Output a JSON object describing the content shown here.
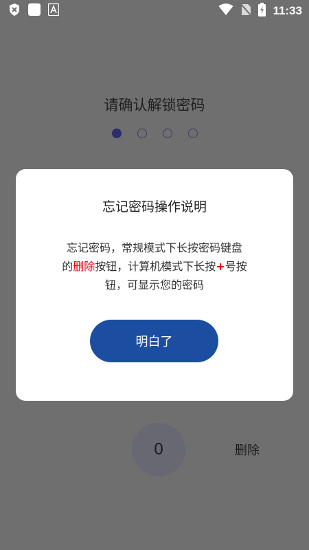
{
  "status_bar": {
    "time": "11:33",
    "icons": [
      "shield-x-icon",
      "square-icon",
      "font-a-icon",
      "wifi-icon",
      "no-sim-icon",
      "battery-charging-icon"
    ]
  },
  "screen": {
    "title": "请确认解锁密码",
    "pin_dots": {
      "filled": 1,
      "total": 4
    },
    "keypad": {
      "zero": "0",
      "delete": "删除"
    }
  },
  "dialog": {
    "title": "忘记密码操作说明",
    "body": {
      "line1": "忘记密码，常规模式下长按密码键盘",
      "line2_pre": "的",
      "line2_red": "删除",
      "line2_mid": "按钮，计算机模式下长按",
      "line2_plus": "+",
      "line2_post": "号按",
      "line3": "钮，可显示您的密码"
    },
    "ok_label": "明白了"
  }
}
